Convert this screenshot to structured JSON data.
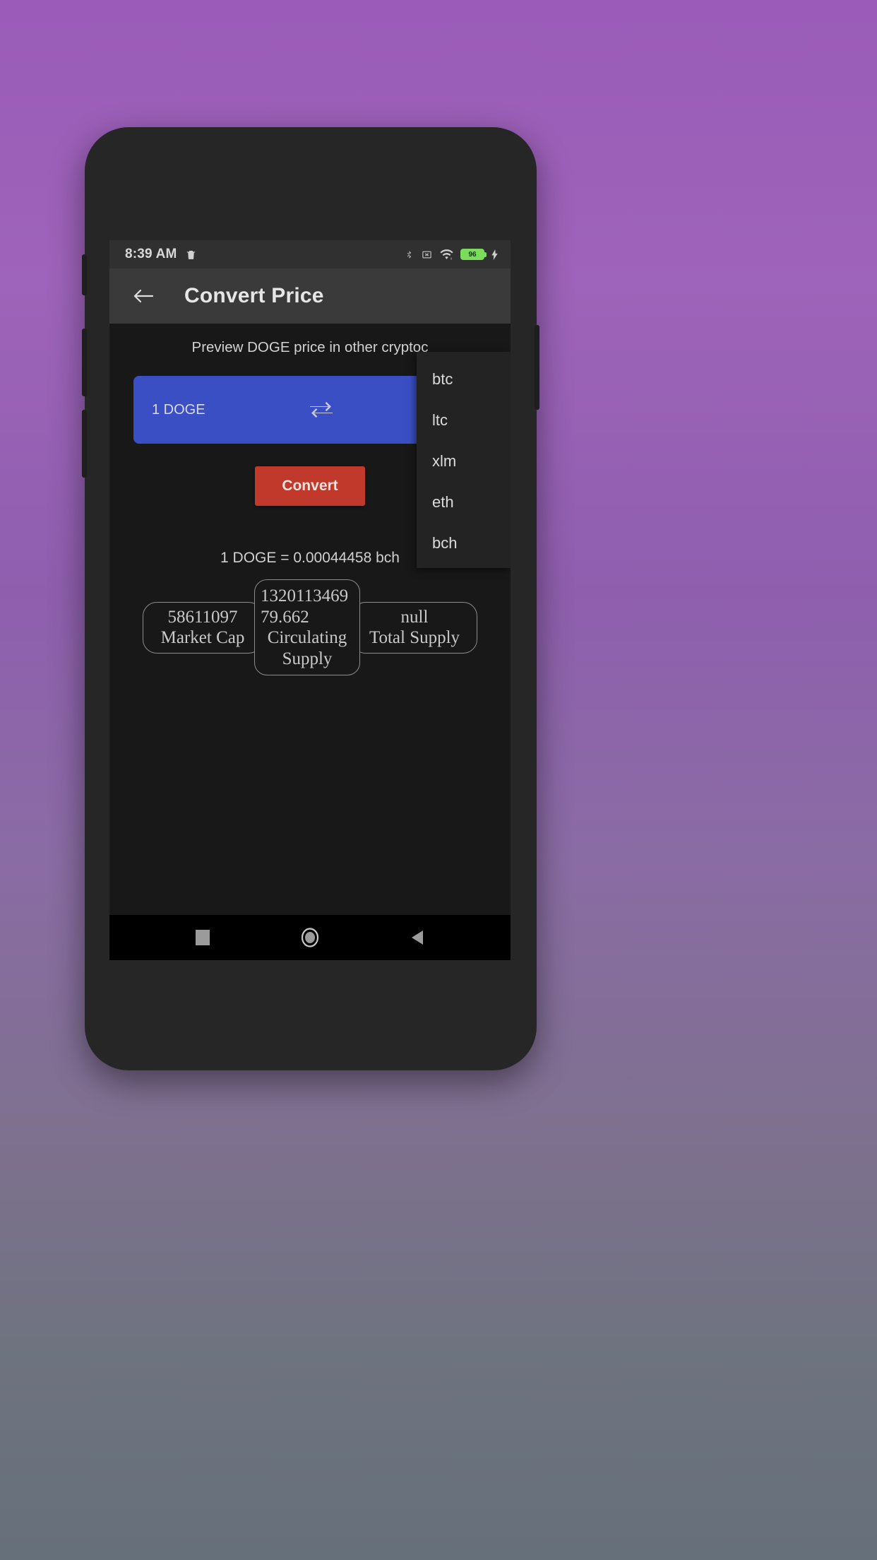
{
  "wallpaper": {
    "top_color": "#9a5cb8",
    "bottom_color": "#66707a"
  },
  "status_bar": {
    "time": "8:39 AM",
    "left_icons": [
      "trash-icon"
    ],
    "right_icons": [
      "bluetooth-icon",
      "sms-error-icon",
      "wifi-icon",
      "charging-bolt-icon"
    ],
    "battery_level": "96"
  },
  "app_bar": {
    "back_icon": "arrow-left-icon",
    "title": "Convert Price"
  },
  "main": {
    "subtitle": "Preview DOGE price in other cryptoc",
    "card": {
      "amount_from": "1 DOGE",
      "swap_icon": "swap-horizontal-icon",
      "currency_to": ""
    },
    "convert_button_label": "Convert",
    "result_text": "1 DOGE = 0.00044458 bch",
    "accent_blue": "#3a4fc4",
    "accent_red": "#c0392b"
  },
  "stats": [
    {
      "value": "58611097",
      "label": "Market Cap",
      "name": "market-cap"
    },
    {
      "value": "132011346979.662",
      "label": "Circulating Supply",
      "name": "circulating-supply"
    },
    {
      "value": "null",
      "label": "Total Supply",
      "name": "total-supply"
    }
  ],
  "dropdown": {
    "items": [
      {
        "label": "btc"
      },
      {
        "label": "ltc"
      },
      {
        "label": "xlm"
      },
      {
        "label": "eth"
      },
      {
        "label": "bch"
      }
    ]
  },
  "nav_bar": {
    "recents_icon": "square-icon",
    "home_icon": "circle-icon",
    "back_icon": "triangle-back-icon"
  }
}
